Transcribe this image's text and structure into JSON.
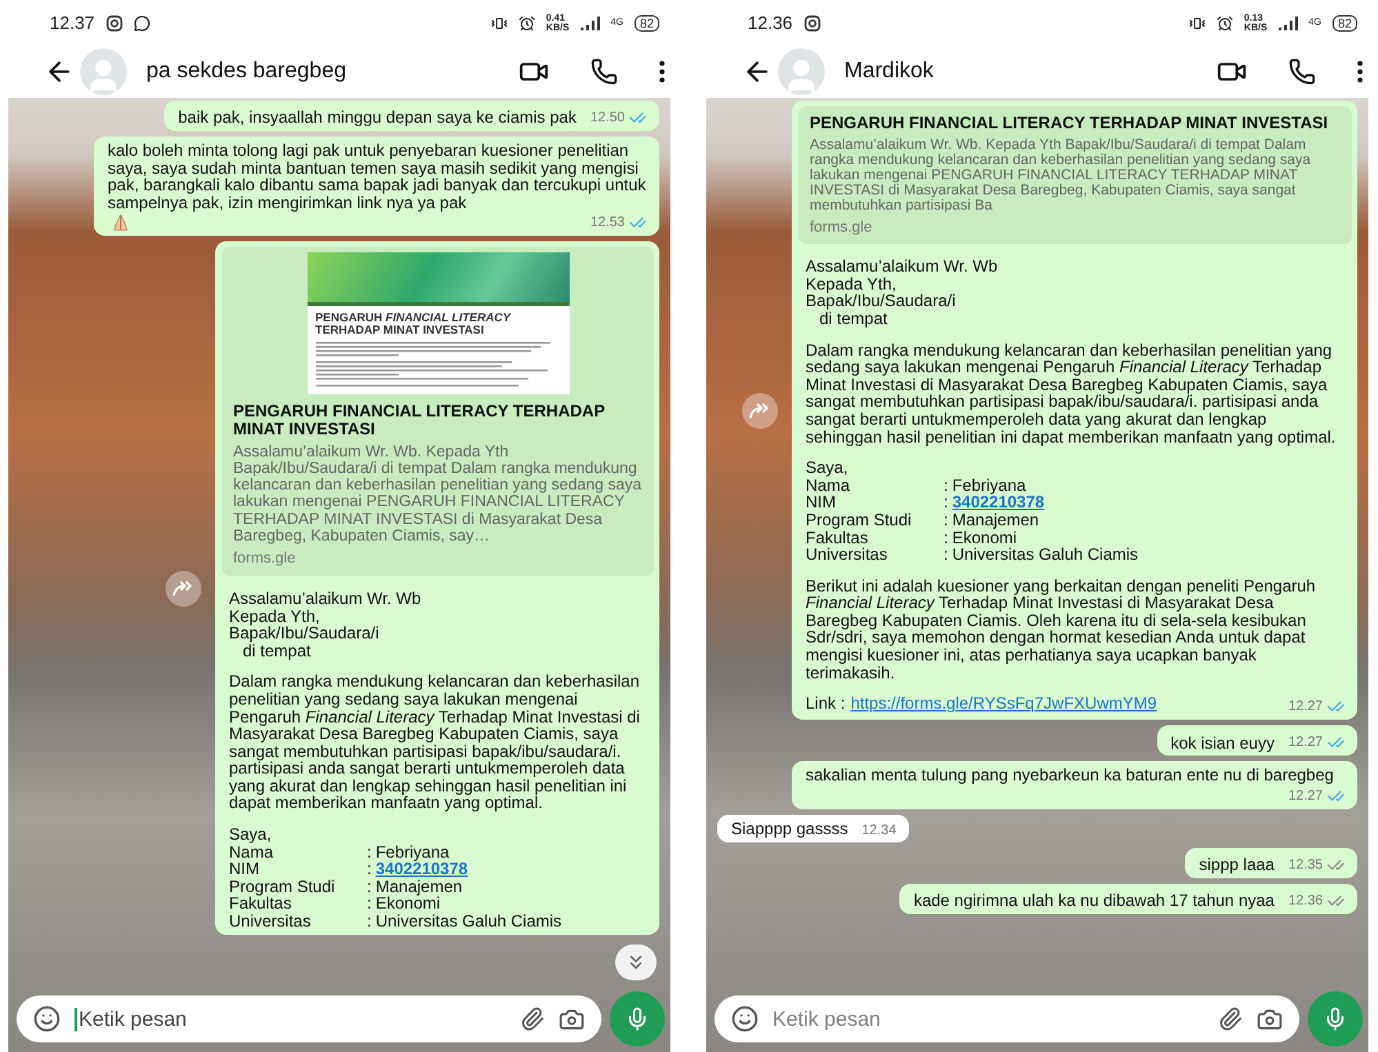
{
  "phones": [
    {
      "status_bar": {
        "time": "12.37",
        "notifications": [
          {
            "kind": "camera-app"
          },
          {
            "kind": "chat-app"
          }
        ],
        "speed": "0.41",
        "speed_unit": "KB/S",
        "network": "4G",
        "battery": "82"
      },
      "contact": {
        "name": "pa sekdes baregbeg"
      },
      "messages": [
        {
          "outgoing": true,
          "blocks": [
            {
              "kind": "paragraph",
              "text": "baik pak, insyaallah minggu depan saya ke ciamis pak"
            }
          ],
          "time": "12.50",
          "read": true
        },
        {
          "outgoing": true,
          "ends_with_emoji": true,
          "blocks": [
            {
              "kind": "paragraph",
              "text": "kalo boleh minta tolong lagi pak untuk penyebaran kuesioner penelitian saya, saya sudah minta bantuan temen saya masih sedikit yang mengisi pak, barangkali kalo dibantu sama bapak jadi banyak dan tercukupi untuk sampelnya pak, izin mengirimkan link nya ya pak"
            }
          ],
          "time": "12.53",
          "read": true
        },
        {
          "outgoing": true,
          "share_button": true,
          "blocks": [
            {
              "kind": "preview",
              "thumbnail": {
                "title": "PENGARUH *FINANCIAL LITERACY* TERHADAP MINAT INVESTASI"
              },
              "title": "PENGARUH FINANCIAL LITERACY TERHADAP MINAT INVESTASI",
              "description": "Assalamu’alaikum Wr. Wb. Kepada Yth Bapak/Ibu/Saudara/i di tempat Dalam rangka mendukung kelancaran dan keberhasilan penelitian yang sedang saya lakukan mengenai PENGARUH FINANCIAL LITERACY TERHADAP MINAT INVESTASI di Masyarakat Desa Baregbeg, Kabupaten Ciamis, say…",
              "domain": "forms.gle"
            },
            {
              "kind": "lines",
              "lines": [
                "Assalamu’alaikum Wr. Wb",
                "Kepada Yth,",
                "Bapak/Ibu/Saudara/i",
                "   di tempat"
              ]
            },
            {
              "kind": "paragraph",
              "text": "Dalam rangka mendukung kelancaran dan keberhasilan penelitian yang sedang saya lakukan mengenai Pengaruh *Financial Literacy* Terhadap Minat Investasi di Masyarakat Desa Baregbeg Kabupaten Ciamis, saya sangat membutuhkan partisipasi bapak/ibu/saudara/i. partisipasi anda sangat berarti untukmemperoleh data yang akurat dan lengkap sehinggan hasil penelitian ini dapat memberikan manfaatn yang optimal."
            },
            {
              "kind": "fields",
              "intro": "Saya,",
              "rows": [
                {
                  "label": "Nama",
                  "separator": ":",
                  "value": "Febriyana",
                  "link": false
                },
                {
                  "label": "NIM",
                  "separator": ":",
                  "value": "3402210378",
                  "link": true
                },
                {
                  "label": "Program Studi",
                  "separator": ":",
                  "value": "Manajemen",
                  "link": false
                },
                {
                  "label": "Fakultas",
                  "separator": ":",
                  "value": "Ekonomi",
                  "link": false
                },
                {
                  "label": "Universitas",
                  "separator": ":",
                  "value": "Universitas Galuh Ciamis",
                  "link": false
                }
              ]
            }
          ]
        }
      ],
      "scroll_down_button": true,
      "composer": {
        "placeholder": "Ketik pesan",
        "focused": true
      }
    },
    {
      "status_bar": {
        "time": "12.36",
        "notifications": [
          {
            "kind": "camera-app"
          }
        ],
        "speed": "0.13",
        "speed_unit": "KB/S",
        "network": "4G",
        "battery": "82"
      },
      "contact": {
        "name": "Mardikok"
      },
      "messages": [
        {
          "outgoing": true,
          "share_button": true,
          "blocks": [
            {
              "kind": "preview",
              "title": "PENGARUH FINANCIAL LITERACY TERHADAP MINAT INVESTASI",
              "description": "Assalamu’alaikum Wr. Wb. Kepada Yth Bapak/Ibu/Saudara/i di tempat Dalam rangka mendukung kelancaran dan keberhasilan penelitian yang sedang saya lakukan mengenai PENGARUH FINANCIAL LITERACY TERHADAP MINAT INVESTASI di Masyarakat Desa Baregbeg, Kabupaten Ciamis, saya sangat membutuhkan partisipasi Ba",
              "domain": "forms.gle"
            },
            {
              "kind": "lines",
              "lines": [
                "Assalamu’alaikum Wr. Wb",
                "Kepada Yth,",
                "Bapak/Ibu/Saudara/i",
                "   di tempat"
              ]
            },
            {
              "kind": "paragraph",
              "text": "Dalam rangka mendukung kelancaran dan keberhasilan penelitian yang sedang saya lakukan mengenai Pengaruh *Financial Literacy* Terhadap Minat Investasi di Masyarakat Desa Baregbeg Kabupaten Ciamis, saya sangat membutuhkan partisipasi bapak/ibu/saudara/i. partisipasi anda sangat berarti untukmemperoleh data yang akurat dan lengkap sehinggan hasil penelitian ini dapat memberikan manfaatn yang optimal."
            },
            {
              "kind": "fields",
              "intro": "Saya,",
              "rows": [
                {
                  "label": "Nama",
                  "separator": ":",
                  "value": "Febriyana",
                  "link": false
                },
                {
                  "label": "NIM",
                  "separator": ":",
                  "value": "3402210378",
                  "link": true
                },
                {
                  "label": "Program Studi",
                  "separator": ":",
                  "value": "Manajemen",
                  "link": false
                },
                {
                  "label": "Fakultas",
                  "separator": ":",
                  "value": "Ekonomi",
                  "link": false
                },
                {
                  "label": "Universitas",
                  "separator": ":",
                  "value": "Universitas Galuh Ciamis",
                  "link": false
                }
              ]
            },
            {
              "kind": "paragraph",
              "text": "Berikut ini adalah kuesioner yang berkaitan dengan peneliti Pengaruh *Financial Literacy* Terhadap Minat Investasi di Masyarakat Desa Baregbeg Kabupaten Ciamis. Oleh karena itu di sela-sela kesibukan Sdr/sdri, saya memohon dengan hormat kesedian Anda untuk dapat mengisi kuesioner ini, atas perhatianya saya ucapkan banyak terimakasih."
            },
            {
              "kind": "link",
              "label": "Link :",
              "url": "https://forms.gle/RYSsFq7JwFXUwmYM9"
            }
          ],
          "time": "12.27",
          "read": true
        },
        {
          "outgoing": true,
          "blocks": [
            {
              "kind": "paragraph",
              "text": "kok isian euyy"
            }
          ],
          "time": "12.27",
          "read": true
        },
        {
          "outgoing": true,
          "blocks": [
            {
              "kind": "paragraph",
              "text": "sakalian menta tulung pang nyebarkeun ka baturan ente nu di baregbeg"
            }
          ],
          "time": "12.27",
          "read": true
        },
        {
          "outgoing": false,
          "blocks": [
            {
              "kind": "paragraph",
              "text": "Siapppp gassss"
            }
          ],
          "time": "12.34"
        },
        {
          "outgoing": true,
          "blocks": [
            {
              "kind": "paragraph",
              "text": "sippp laaa"
            }
          ],
          "time": "12.35",
          "read": false
        },
        {
          "outgoing": true,
          "blocks": [
            {
              "kind": "paragraph",
              "text": "kade ngirimna ulah ka nu dibawah 17 tahun nyaa"
            }
          ],
          "time": "12.36",
          "read": false
        }
      ],
      "scroll_down_button": false,
      "composer": {
        "placeholder": "Ketik pesan",
        "focused": false
      }
    }
  ]
}
